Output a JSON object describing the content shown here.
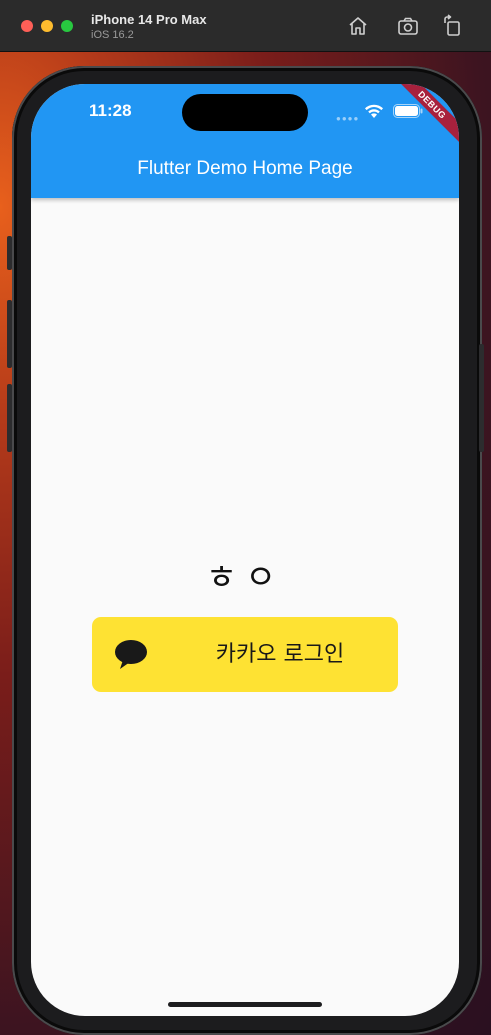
{
  "simulator": {
    "device_name": "iPhone 14 Pro Max",
    "os_version": "iOS 16.2",
    "icons": [
      "home-icon",
      "screenshot-icon",
      "rotate-icon"
    ]
  },
  "status_bar": {
    "time": "11:28",
    "icons": [
      "wifi-icon",
      "battery-icon"
    ]
  },
  "debug_banner": "DEBUG",
  "app_bar": {
    "title": "Flutter Demo Home Page",
    "color": "#2196f3"
  },
  "body": {
    "greeting_text": "ㅎㅇ",
    "kakao_button": {
      "label": "카카오 로그인",
      "icon": "speech-bubble-icon",
      "color": "#fee233"
    }
  }
}
